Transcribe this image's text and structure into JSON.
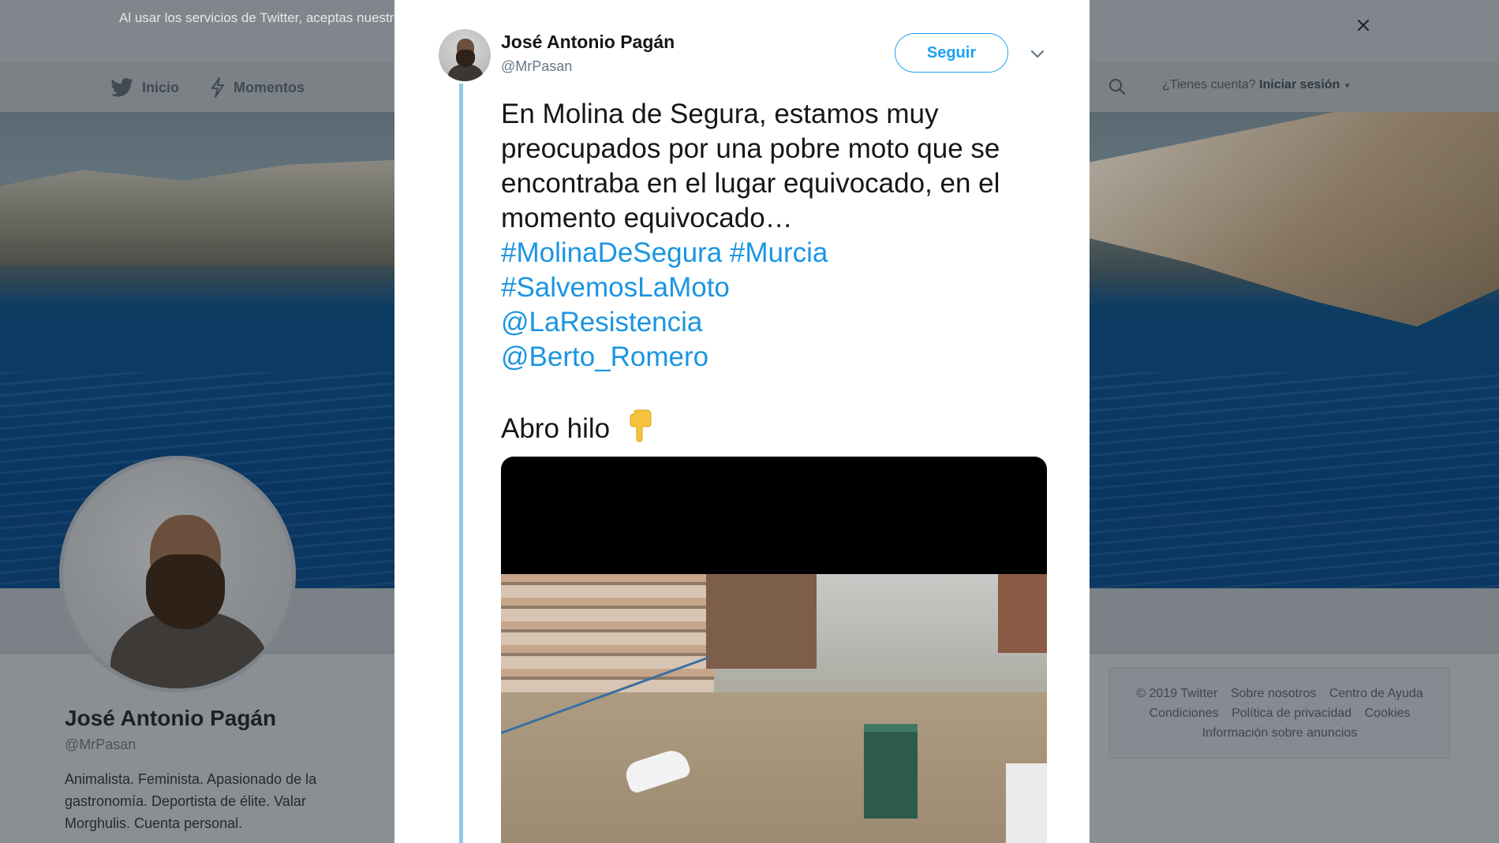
{
  "cookie_banner": {
    "text": "Al usar los servicios de Twitter, aceptas nuestra Política de cookies y el uso de cookies para mejorar tu experiencia, personalización y anuncios, entre otras cosas."
  },
  "nav": {
    "home_label": "Inicio",
    "moments_label": "Momentos",
    "have_account": "¿Tienes cuenta?",
    "login_label": "Iniciar sesión"
  },
  "profile": {
    "name": "José Antonio Pagán",
    "handle": "@MrPasan",
    "bio": "Animalista. Feminista. Apasionado de la gastronomía. Deportista de élite. Valar Morghulis. Cuenta personal."
  },
  "footer": {
    "links_row1": [
      "© 2019 Twitter",
      "Sobre nosotros",
      "Centro de Ayuda"
    ],
    "links_row2": [
      "Condiciones",
      "Política de privacidad",
      "Cookies"
    ],
    "links_row3": [
      "Información sobre anuncios"
    ]
  },
  "tweet": {
    "author_name": "José Antonio Pagán",
    "author_handle": "@MrPasan",
    "follow_label": "Seguir",
    "text": "En Molina de Segura, estamos muy preocupados por una pobre moto que se encontraba en el lugar equivocado, en el momento equivocado…",
    "hashtags": [
      "#MolinaDeSegura",
      "#Murcia",
      "#SalvemosLa",
      "Moto"
    ],
    "mentions": [
      "@LaResistencia",
      "@Berto_Romero"
    ],
    "closing": "Abro hilo"
  },
  "icons": {
    "twitter_bird": "twitter-bird-icon",
    "moments": "lightning-icon",
    "search": "search-icon",
    "close": "close-icon",
    "chevron": "chevron-down-icon",
    "emoji": "pointing-down-emoji"
  },
  "colors": {
    "accent": "#1da1f2",
    "link": "#1b95e0",
    "thread_line": "#8ecbe6"
  }
}
